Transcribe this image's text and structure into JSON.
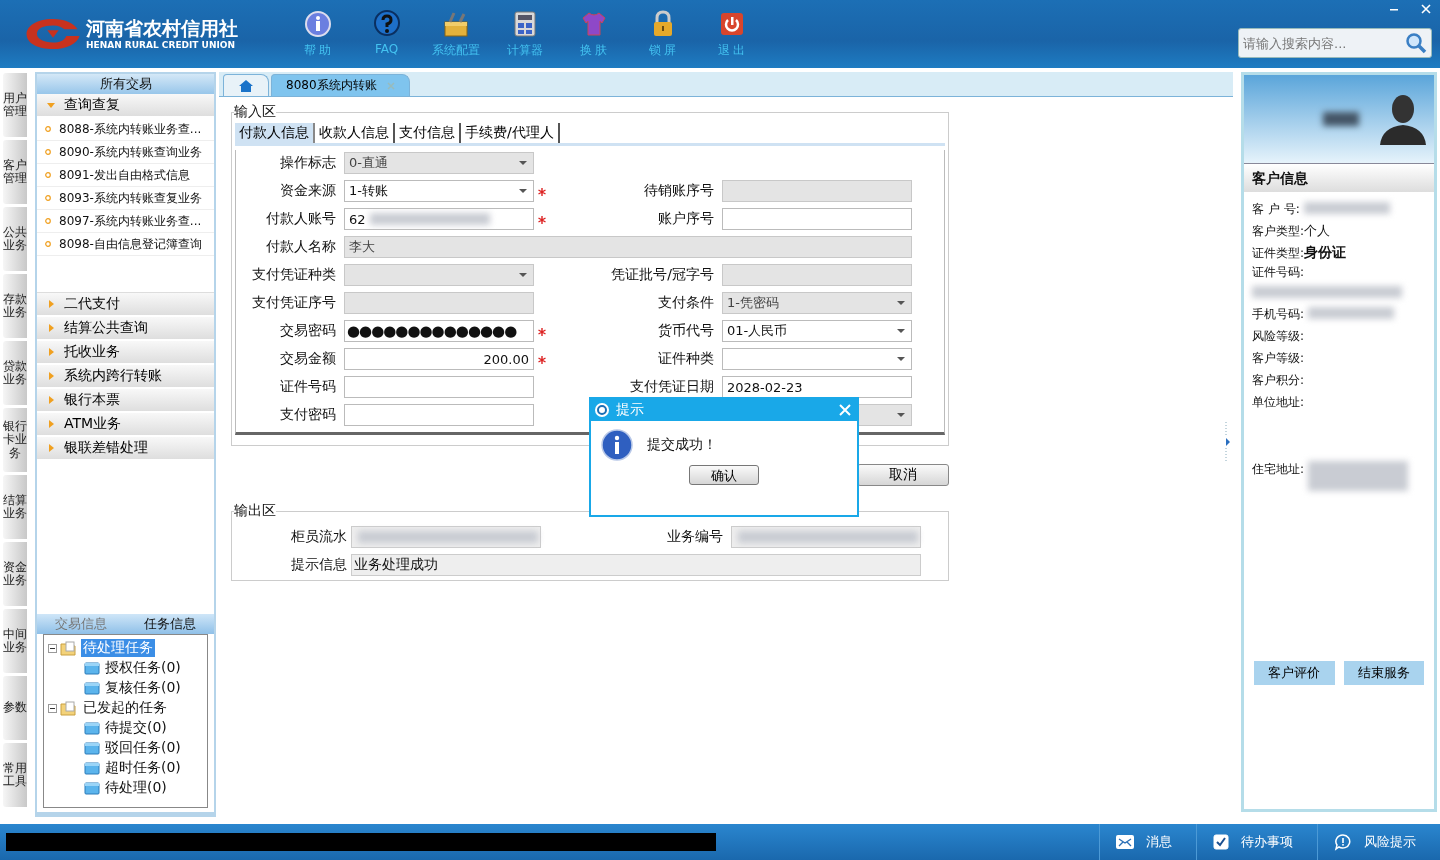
{
  "header": {
    "logo_cn": "河南省农村信用社",
    "logo_en": "HENAN RURAL CREDIT UNION",
    "nav": [
      {
        "label": "帮 助"
      },
      {
        "label": "FAQ"
      },
      {
        "label": "系统配置"
      },
      {
        "label": "计算器"
      },
      {
        "label": "换 肤"
      },
      {
        "label": "锁 屏"
      },
      {
        "label": "退 出"
      }
    ],
    "search": {
      "placeholder": "请输入搜索内容..."
    }
  },
  "side_tabs": [
    "用户管理",
    "客户管理",
    "公共业务",
    "存款业务",
    "贷款业务",
    "银行卡业务",
    "结算业务",
    "资金业务",
    "中间业务",
    "参数",
    "常用工具"
  ],
  "menu": {
    "title": "所有交易",
    "sections": [
      {
        "label": "查询查复",
        "expanded": true,
        "items": [
          "8088-系统内转账业务查...",
          "8090-系统内转账查询业务",
          "8091-发出自由格式信息",
          "8093-系统内转账查复业务",
          "8097-系统内转账业务查...",
          "8098-自由信息登记簿查询"
        ]
      },
      {
        "label": "二代支付",
        "expanded": false
      },
      {
        "label": "结算公共查询",
        "expanded": false
      },
      {
        "label": "托收业务",
        "expanded": false
      },
      {
        "label": "系统内跨行转账",
        "expanded": false
      },
      {
        "label": "银行本票",
        "expanded": false
      },
      {
        "label": "ATM业务",
        "expanded": false
      },
      {
        "label": "银联差错处理",
        "expanded": false
      }
    ]
  },
  "task_panel": {
    "tabs": [
      {
        "label": "交易信息",
        "selected": false
      },
      {
        "label": "任务信息",
        "selected": true
      }
    ],
    "tree": [
      {
        "label": "待处理任务",
        "selected": true,
        "expanded": true,
        "children": [
          {
            "label": "授权任务(0)",
            "selected": false
          },
          {
            "label": "复核任务(0)",
            "selected": false
          }
        ]
      },
      {
        "label": "已发起的任务",
        "selected": false,
        "expanded": true,
        "children": [
          {
            "label": "待提交(0)",
            "selected": false
          },
          {
            "label": "驳回任务(0)",
            "selected": false
          },
          {
            "label": "超时任务(0)",
            "selected": false
          },
          {
            "label": "待处理(0)",
            "selected": false
          }
        ]
      }
    ]
  },
  "doc_tabs": [
    {
      "kind": "home",
      "selected": false
    },
    {
      "kind": "page",
      "label": "8080系统内转账",
      "selected": true
    }
  ],
  "input_area": {
    "title": "输入区",
    "tabs": [
      {
        "label": "付款人信息",
        "selected": true
      },
      {
        "label": "收款人信息",
        "selected": false
      },
      {
        "label": "支付信息",
        "selected": false
      },
      {
        "label": "手续费/代理人",
        "selected": false
      }
    ],
    "rows": [
      {
        "left": {
          "label": "操作标志",
          "kind": "select",
          "value": "0-直通",
          "readonly": true
        }
      },
      {
        "left": {
          "label": "资金来源",
          "kind": "select",
          "value": "1-转账",
          "readonly": false,
          "required": true
        },
        "right": {
          "label": "待销账序号",
          "kind": "text",
          "readonly": true
        }
      },
      {
        "left": {
          "label": "付款人账号",
          "kind": "text",
          "value": "62",
          "redacted": true,
          "readonly": false,
          "required": true
        },
        "right": {
          "label": "账户序号",
          "kind": "text",
          "readonly": false
        }
      },
      {
        "wide": true,
        "left": {
          "label": "付款人名称",
          "kind": "text",
          "value": "李大",
          "readonly": true
        }
      },
      {
        "left": {
          "label": "支付凭证种类",
          "kind": "select",
          "readonly": true
        },
        "right": {
          "label": "凭证批号/冠字号",
          "kind": "text",
          "readonly": true
        }
      },
      {
        "left": {
          "label": "支付凭证序号",
          "kind": "text",
          "readonly": true
        },
        "right": {
          "label": "支付条件",
          "kind": "select",
          "value": "1-凭密码",
          "readonly": true
        }
      },
      {
        "left": {
          "label": "交易密码",
          "kind": "password",
          "value": "●●●●●●●●●●●●●●",
          "readonly": false,
          "required": true
        },
        "right": {
          "label": "货币代号",
          "kind": "select",
          "value": "01-人民币",
          "readonly": false
        }
      },
      {
        "left": {
          "label": "交易金额",
          "kind": "amount",
          "value": "200.00",
          "readonly": false,
          "required": true
        },
        "right": {
          "label": "证件种类",
          "kind": "select",
          "readonly": false
        }
      },
      {
        "left": {
          "label": "证件号码",
          "kind": "text",
          "readonly": false
        },
        "right": {
          "label": "支付凭证日期",
          "kind": "text",
          "value": "2028-02-23",
          "readonly": false
        }
      },
      {
        "left": {
          "label": "支付密码",
          "kind": "text",
          "readonly": false
        },
        "right": {
          "kind": "select",
          "readonly": true
        }
      }
    ]
  },
  "cancel_button": "取消",
  "output_area": {
    "title": "输出区",
    "rows": [
      {
        "left": {
          "label": "柜员流水",
          "redacted": true
        },
        "right": {
          "label": "业务编号",
          "redacted": true
        }
      },
      {
        "wide": true,
        "left": {
          "label": "提示信息",
          "value": "业务处理成功"
        }
      }
    ]
  },
  "profile": {
    "name_redacted": true
  },
  "customer_info": {
    "title": "客户信息",
    "rows": [
      {
        "label": "客 户 号:",
        "redacted": true
      },
      {
        "label": "客户类型:",
        "value": "个人",
        "bold": false
      },
      {
        "label": "证件类型:",
        "value": "身份证",
        "bold": true
      },
      {
        "label": "证件号码:",
        "redacted": true,
        "below": true
      },
      {
        "label": "手机号码:",
        "redacted": true
      },
      {
        "label": "风险等级:"
      },
      {
        "label": "客户等级:"
      },
      {
        "label": "客户积分:"
      },
      {
        "label": "单位地址:",
        "kind": "address"
      },
      {
        "label": "住宅地址:",
        "kind": "address",
        "redacted": true
      }
    ],
    "buttons": [
      "客户评价",
      "结束服务"
    ]
  },
  "dialog": {
    "title": "提示",
    "message": "提交成功！",
    "button": "确认"
  },
  "status_bar": {
    "items": [
      {
        "kind": "message",
        "label": "消息"
      },
      {
        "kind": "todo",
        "label": "待办事项"
      },
      {
        "kind": "risk",
        "label": "风险提示"
      }
    ]
  }
}
